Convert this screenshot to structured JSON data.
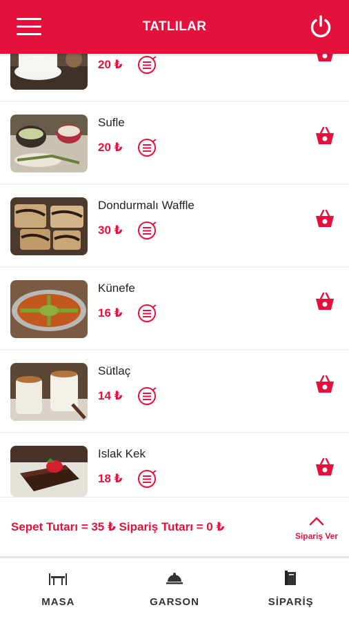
{
  "header": {
    "title": "TATLILAR"
  },
  "items": [
    {
      "name": "",
      "price": "20 ₺"
    },
    {
      "name": "Sufle",
      "price": "20 ₺"
    },
    {
      "name": "Dondurmalı Waffle",
      "price": "30 ₺"
    },
    {
      "name": "Künefe",
      "price": "16 ₺"
    },
    {
      "name": "Sütlaç",
      "price": "14 ₺"
    },
    {
      "name": "Islak Kek",
      "price": "18 ₺"
    }
  ],
  "summary": {
    "totals": "Sepet Tutarı = 35 ₺ Sipariş Tutarı = 0 ₺",
    "order_label": "Sipariş Ver"
  },
  "tabs": [
    {
      "label": "MASA",
      "icon": "table-icon"
    },
    {
      "label": "GARSON",
      "icon": "waiter-bell-icon"
    },
    {
      "label": "SİPARİŞ",
      "icon": "order-book-icon"
    }
  ],
  "colors": {
    "accent": "#e5113d"
  }
}
